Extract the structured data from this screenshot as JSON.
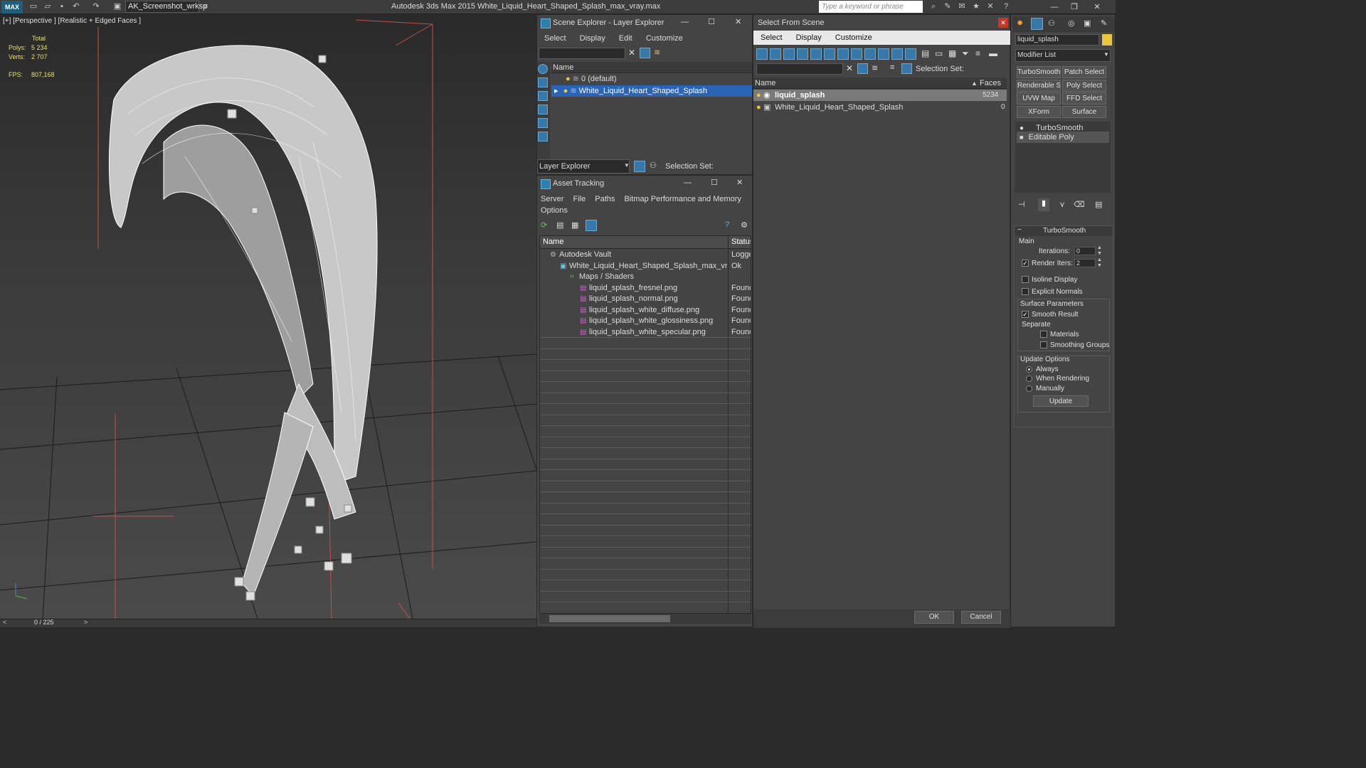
{
  "app": {
    "logo_text": "MAX",
    "workspace": "AK_Screenshot_wrksp",
    "title": "Autodesk 3ds Max  2015     White_Liquid_Heart_Shaped_Splash_max_vray.max",
    "search_placeholder": "Type a keyword or phrase"
  },
  "viewport": {
    "label": "[+] [Perspective ] [Realistic + Edged Faces ]",
    "stats_header": "Total",
    "polys_label": "Polys:",
    "polys_value": "5 234",
    "verts_label": "Verts:",
    "verts_value": "2 707",
    "fps_label": "FPS:",
    "fps_value": "807,168",
    "timeline": "0 / 225"
  },
  "scene_explorer": {
    "title": "Scene Explorer - Layer Explorer",
    "menu": [
      "Select",
      "Display",
      "Edit",
      "Customize"
    ],
    "col_name": "Name",
    "rows": [
      "0 (default)",
      "White_Liquid_Heart_Shaped_Splash"
    ],
    "footer_combo": "Layer Explorer",
    "selection_set": "Selection Set:"
  },
  "asset_tracking": {
    "title": "Asset Tracking",
    "menu": [
      "Server",
      "File",
      "Paths",
      "Bitmap Performance and Memory"
    ],
    "menu2": "Options",
    "col_name": "Name",
    "col_status": "Status",
    "rows": [
      {
        "name": "Autodesk Vault",
        "status": "Logged"
      },
      {
        "name": "White_Liquid_Heart_Shaped_Splash_max_vray.m...",
        "status": "Ok"
      },
      {
        "name": "Maps / Shaders",
        "status": ""
      },
      {
        "name": "liquid_splash_fresnel.png",
        "status": "Found"
      },
      {
        "name": "liquid_splash_normal.png",
        "status": "Found"
      },
      {
        "name": "liquid_splash_white_diffuse.png",
        "status": "Found"
      },
      {
        "name": "liquid_splash_white_glossiness.png",
        "status": "Found"
      },
      {
        "name": "liquid_splash_white_specular.png",
        "status": "Found"
      }
    ]
  },
  "select_from_scene": {
    "title": "Select From Scene",
    "menu": [
      "Select",
      "Display",
      "Customize"
    ],
    "selection_set": "Selection Set:",
    "col_name": "Name",
    "col_faces": "Faces",
    "rows": [
      {
        "name": "liquid_splash",
        "faces": "5234"
      },
      {
        "name": "White_Liquid_Heart_Shaped_Splash",
        "faces": "0"
      }
    ],
    "ok": "OK",
    "cancel": "Cancel"
  },
  "modify_panel": {
    "object_name": "liquid_splash",
    "modifier_list": "Modifier List",
    "buttons": [
      "TurboSmooth",
      "Patch Select",
      "Renderable Spline",
      "Poly Select",
      "UVW Map",
      "FFD Select",
      "XForm",
      "Surface Select"
    ],
    "stack": [
      "TurboSmooth",
      "Editable Poly"
    ],
    "rollout_title": "TurboSmooth",
    "main_label": "Main",
    "iterations_label": "Iterations:",
    "iterations_value": "0",
    "render_iters_label": "Render Iters:",
    "render_iters_value": "2",
    "isoline": "Isoline Display",
    "explicit": "Explicit Normals",
    "surface_params": "Surface Parameters",
    "smooth_result": "Smooth Result",
    "separate": "Separate",
    "materials": "Materials",
    "smoothing_groups": "Smoothing Groups",
    "update_options": "Update Options",
    "always": "Always",
    "when_rendering": "When Rendering",
    "manually": "Manually",
    "update": "Update"
  },
  "colors": {
    "selection": "#2b63b5",
    "stats_text": "#e8e070"
  }
}
